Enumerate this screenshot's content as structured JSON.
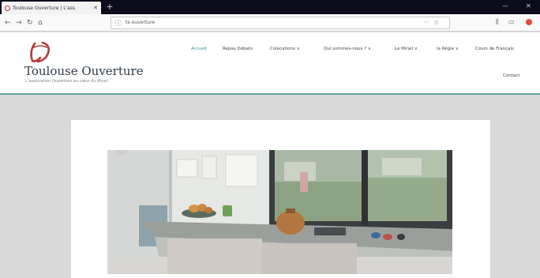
{
  "browser": {
    "tab_title": "Toulouse Ouverture | L'ass",
    "tab_close_glyph": "✕",
    "new_tab_glyph": "+",
    "url_text": "ts-ouverture",
    "minimize_glyph": "—",
    "close_glyph": "✕"
  },
  "site": {
    "title": "Toulouse Ouverture",
    "tagline": "L'association Ouverture au cœur du Mirail",
    "accent_color": "#2a9b8f",
    "logo_color": "#b23a3a",
    "menu": [
      {
        "label": "Accueil"
      },
      {
        "label": "Repas Débats"
      },
      {
        "label": "Colocations ∨"
      },
      {
        "label": "Qui sommes-nous ? ∨"
      },
      {
        "label": "Le Mirail ∨"
      },
      {
        "label": "la Régie ∨"
      },
      {
        "label": "Cours de Français"
      }
    ],
    "contact_label": "Contact"
  }
}
